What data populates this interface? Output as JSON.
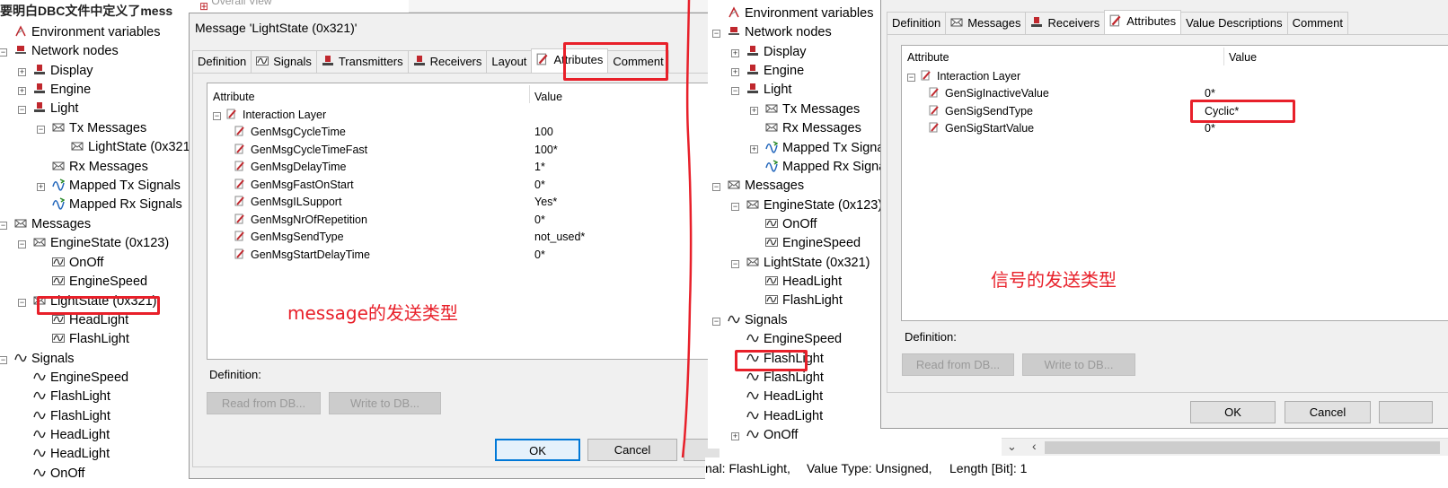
{
  "left_tree": {
    "cut_title": "要明白DBC文件中定义了mess",
    "items": [
      {
        "label": "Environment variables",
        "icon": "env-icon"
      },
      {
        "label": "Network nodes",
        "icon": "node-icon"
      },
      {
        "label": "Display",
        "icon": "ecu-icon"
      },
      {
        "label": "Engine",
        "icon": "ecu-icon"
      },
      {
        "label": "Light",
        "icon": "ecu-icon"
      },
      {
        "label": "Tx Messages",
        "icon": "message-icon"
      },
      {
        "label": "LightState (0x321",
        "icon": "message-icon"
      },
      {
        "label": "Rx Messages",
        "icon": "message-icon"
      },
      {
        "label": "Mapped Tx Signals",
        "icon": "mapped-icon"
      },
      {
        "label": "Mapped Rx Signals",
        "icon": "mapped-icon"
      },
      {
        "label": "Messages",
        "icon": "message-icon"
      },
      {
        "label": "EngineState (0x123)",
        "icon": "message-icon"
      },
      {
        "label": "OnOff",
        "icon": "signal-icon"
      },
      {
        "label": "EngineSpeed",
        "icon": "signal-icon"
      },
      {
        "label": "LightState (0x321)",
        "icon": "message-icon"
      },
      {
        "label": "HeadLight",
        "icon": "signal-icon"
      },
      {
        "label": "FlashLight",
        "icon": "signal-icon"
      },
      {
        "label": "Signals",
        "icon": "wave-icon"
      },
      {
        "label": "EngineSpeed",
        "icon": "wave-icon"
      },
      {
        "label": "FlashLight",
        "icon": "wave-icon"
      },
      {
        "label": "FlashLight",
        "icon": "wave-icon"
      },
      {
        "label": "HeadLight",
        "icon": "wave-icon"
      },
      {
        "label": "HeadLight",
        "icon": "wave-icon"
      },
      {
        "label": "OnOff",
        "icon": "wave-icon"
      }
    ],
    "overall_view": "Overall View"
  },
  "msg_dialog": {
    "title": "Message 'LightState (0x321)'",
    "tabs": [
      "Definition",
      "Signals",
      "Transmitters",
      "Receivers",
      "Layout",
      "Attributes",
      "Comment"
    ],
    "active_tab": "Attributes",
    "col_attribute": "Attribute",
    "col_value": "Value",
    "group": "Interaction Layer",
    "rows": [
      {
        "attr": "GenMsgCycleTime",
        "value": "100"
      },
      {
        "attr": "GenMsgCycleTimeFast",
        "value": "100*"
      },
      {
        "attr": "GenMsgDelayTime",
        "value": "1*"
      },
      {
        "attr": "GenMsgFastOnStart",
        "value": "0*"
      },
      {
        "attr": "GenMsgILSupport",
        "value": "Yes*"
      },
      {
        "attr": "GenMsgNrOfRepetition",
        "value": "0*"
      },
      {
        "attr": "GenMsgSendType",
        "value": "not_used*"
      },
      {
        "attr": "GenMsgStartDelayTime",
        "value": "0*"
      }
    ],
    "definition_label": "Definition:",
    "read_btn": "Read from DB...",
    "write_btn": "Write to DB...",
    "ok": "OK",
    "cancel": "Cancel",
    "annotation": "message的发送类型"
  },
  "mid_tree": {
    "items": [
      {
        "label": "Environment variables"
      },
      {
        "label": "Network nodes"
      },
      {
        "label": "Display"
      },
      {
        "label": "Engine"
      },
      {
        "label": "Light"
      },
      {
        "label": "Tx Messages"
      },
      {
        "label": "Rx Messages"
      },
      {
        "label": "Mapped Tx Signals"
      },
      {
        "label": "Mapped Rx Signals"
      },
      {
        "label": "Messages"
      },
      {
        "label": "EngineState (0x123)"
      },
      {
        "label": "OnOff"
      },
      {
        "label": "EngineSpeed"
      },
      {
        "label": "LightState (0x321)"
      },
      {
        "label": "HeadLight"
      },
      {
        "label": "FlashLight"
      },
      {
        "label": "Signals"
      },
      {
        "label": "EngineSpeed"
      },
      {
        "label": "FlashLight"
      },
      {
        "label": "FlashLight"
      },
      {
        "label": "HeadLight"
      },
      {
        "label": "HeadLight"
      },
      {
        "label": "OnOff"
      }
    ]
  },
  "status_bar": {
    "name": "nal: FlashLight,",
    "value_type": "Value Type: Unsigned,",
    "length": "Length [Bit]: 1"
  },
  "sig_dialog": {
    "tabs": [
      "Definition",
      "Messages",
      "Receivers",
      "Attributes",
      "Value Descriptions",
      "Comment"
    ],
    "active_tab": "Attributes",
    "col_attribute": "Attribute",
    "col_value": "Value",
    "group": "Interaction Layer",
    "rows": [
      {
        "attr": "GenSigInactiveValue",
        "value": "0*"
      },
      {
        "attr": "GenSigSendType",
        "value": "Cyclic*"
      },
      {
        "attr": "GenSigStartValue",
        "value": "0*"
      }
    ],
    "definition_label": "Definition:",
    "read_btn": "Read from DB...",
    "write_btn": "Write to DB...",
    "ok": "OK",
    "cancel": "Cancel",
    "annotation": "信号的发送类型"
  },
  "colors": {
    "annotation_red": "#e8202a",
    "ecu_red": "#c0282e",
    "selection": "#cce8ff"
  }
}
